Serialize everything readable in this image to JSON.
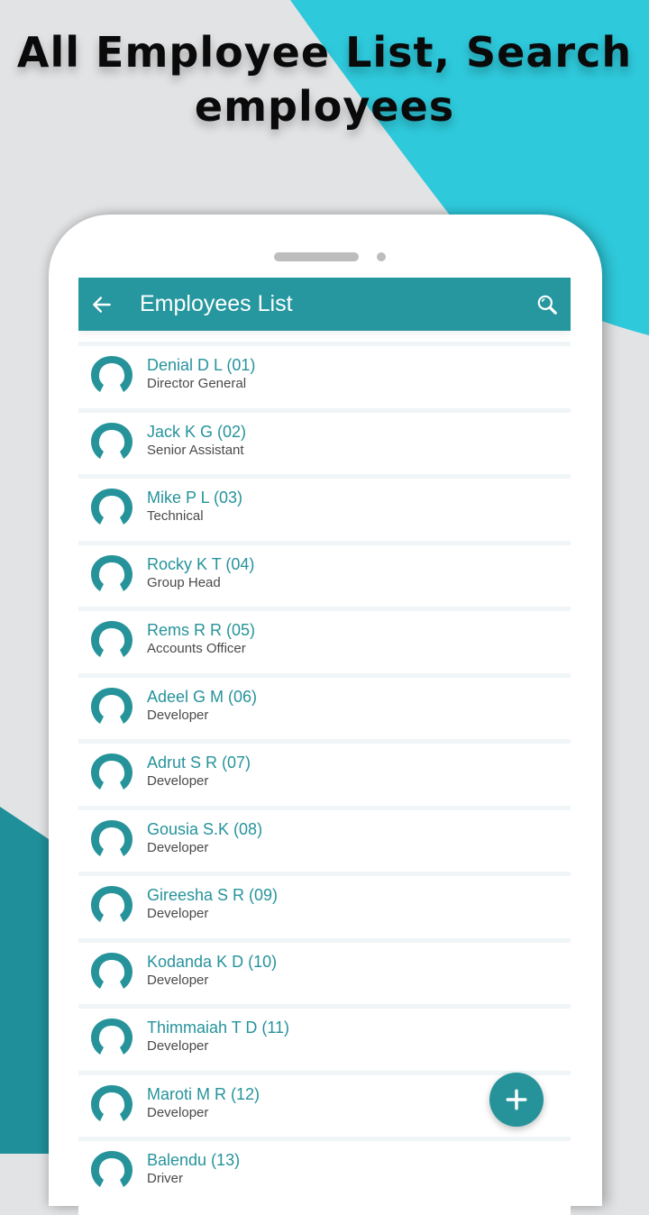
{
  "promo": {
    "headline_line1": "All Employee List, Search",
    "headline_line2": "employees"
  },
  "colors": {
    "accent": "#26979f",
    "name_text": "#26939b",
    "role_text": "#4a4a4a",
    "background_gray": "#e2e3e5",
    "background_cyan": "#2ec9db",
    "background_teal": "#1f8f99"
  },
  "appbar": {
    "title": "Employees List",
    "back_icon": "arrow-left-icon",
    "search_icon": "search-icon"
  },
  "employees": [
    {
      "name": "Denial D L (01)",
      "role": "Director General"
    },
    {
      "name": "Jack K G (02)",
      "role": "Senior Assistant"
    },
    {
      "name": "Mike P L (03)",
      "role": "Technical"
    },
    {
      "name": "Rocky K T (04)",
      "role": "Group Head"
    },
    {
      "name": "Rems R R (05)",
      "role": "Accounts Officer"
    },
    {
      "name": "Adeel G M (06)",
      "role": "Developer"
    },
    {
      "name": "Adrut S R (07)",
      "role": "Developer"
    },
    {
      "name": "Gousia S.K (08)",
      "role": "Developer"
    },
    {
      "name": "Gireesha S R (09)",
      "role": "Developer"
    },
    {
      "name": "Kodanda K D (10)",
      "role": "Developer"
    },
    {
      "name": "Thimmaiah T D (11)",
      "role": "Developer"
    },
    {
      "name": "Maroti M R (12)",
      "role": "Developer"
    },
    {
      "name": "Balendu (13)",
      "role": "Driver"
    }
  ],
  "fab": {
    "icon": "plus-icon"
  }
}
